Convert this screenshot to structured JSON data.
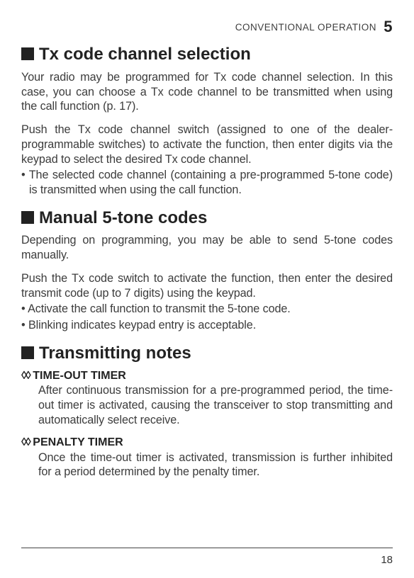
{
  "header": {
    "running_title": "CONVENTIONAL OPERATION",
    "chapter_number": "5"
  },
  "sections": {
    "tx": {
      "title": "Tx code channel selection",
      "p1": "Your radio may be programmed for Tx code channel selection. In this case, you can choose a Tx code channel to be transmitted when using the call function (p. 17).",
      "p2": "Push the Tx code channel switch (assigned to one of the dealer-programmable switches) to activate the function, then enter digits via the keypad to select the desired Tx code channel.",
      "b1": "• The selected code channel (containing a pre-programmed 5-tone code) is transmitted when using the call function."
    },
    "manual": {
      "title": "Manual 5-tone codes",
      "p1": "Depending on programming, you may be able to send 5-tone codes manually.",
      "p2": "Push the Tx code switch to activate the function, then enter the desired transmit code (up to 7 digits) using the keypad.",
      "b1": "• Activate the call function to transmit the 5-tone code.",
      "b2": "• Blinking indicates keypad entry is acceptable."
    },
    "notes": {
      "title": "Transmitting notes",
      "sub1_title": "TIME-OUT TIMER",
      "sub1_body": "After continuous transmission for a pre-programmed period, the time-out timer is activated, causing the transceiver to stop transmitting and automatically select receive.",
      "sub2_title": "PENALTY TIMER",
      "sub2_body": "Once the time-out timer is activated, transmission is further inhibited for a period determined by the penalty timer."
    }
  },
  "footer": {
    "page_number": "18"
  },
  "glyphs": {
    "diamond_pair": "◊◊ "
  }
}
